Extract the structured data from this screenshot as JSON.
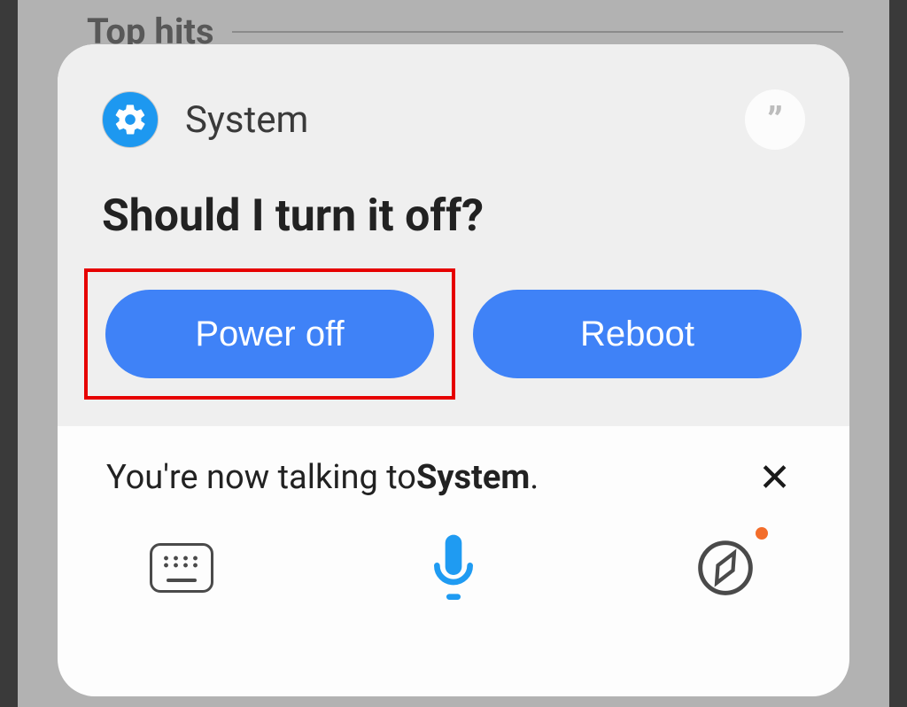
{
  "background": {
    "top_hits_label": "Top hits"
  },
  "card": {
    "header": {
      "icon_name": "settings-gear-icon",
      "title": "System",
      "quote_badge": "”"
    },
    "prompt": "Should I turn it off?",
    "buttons": {
      "power_off": "Power off",
      "reboot": "Reboot"
    },
    "highlight": "power_off",
    "colors": {
      "button_bg": "#3f82f7",
      "highlight_border": "#e60000"
    }
  },
  "status": {
    "prefix": "You're now talking to ",
    "subject": "System",
    "suffix": "."
  },
  "bottom_bar": {
    "keyboard_icon": "keyboard-icon",
    "mic_icon": "microphone-icon",
    "compass_icon": "compass-icon",
    "compass_has_badge": true
  }
}
